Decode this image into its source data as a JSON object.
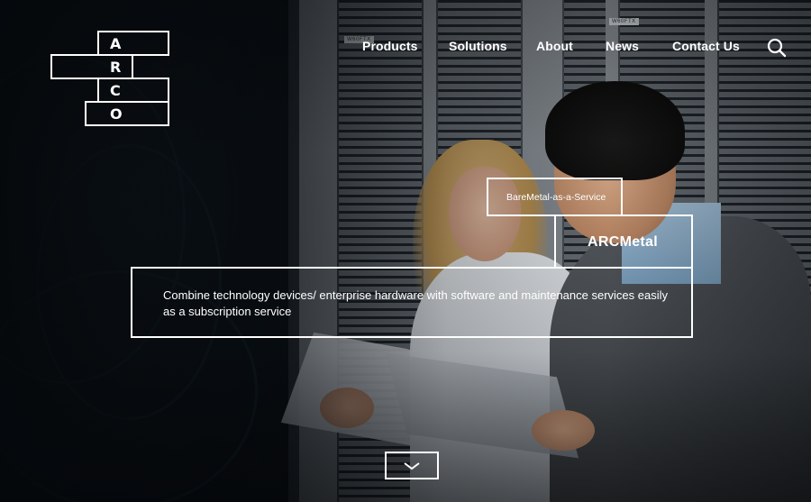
{
  "logo": {
    "letters": [
      "A",
      "R",
      "C",
      "O"
    ]
  },
  "nav": {
    "items": [
      {
        "label": "Products"
      },
      {
        "label": "Solutions"
      },
      {
        "label": "About"
      },
      {
        "label": "News"
      },
      {
        "label": "Contact Us"
      }
    ],
    "search_icon": "search-icon"
  },
  "hero": {
    "tag": "BareMetal-as-a-Service",
    "title": "ARCMetal",
    "description": "Combine technology devices/ enterprise hardware with software and maintenance services easily as a subscription service",
    "scroll_icon": "chevron-down-icon"
  },
  "colors": {
    "text": "#ffffff",
    "background": "#0d1013"
  }
}
